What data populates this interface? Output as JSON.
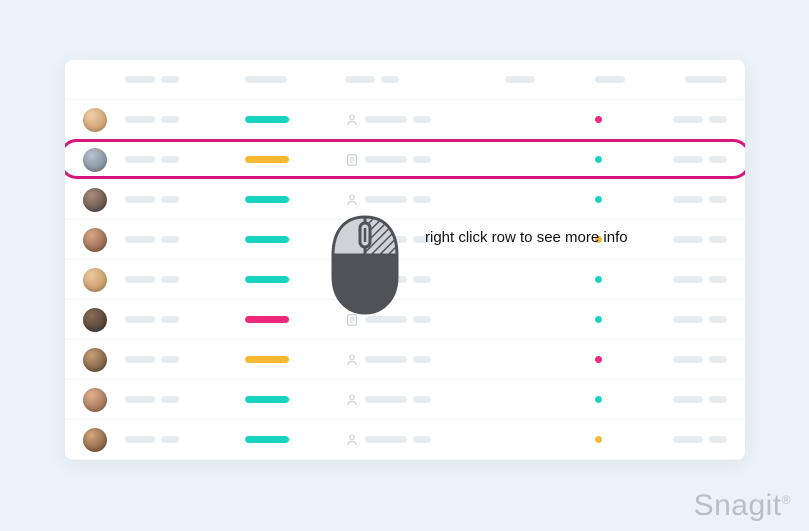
{
  "annotation": {
    "text": "right click row to see more info",
    "highlight_color": "#d6157d"
  },
  "watermark": {
    "brand": "Snagit",
    "mark": "®"
  },
  "colors": {
    "teal": "#17d3c0",
    "amber": "#f7b731",
    "pink": "#ef2879"
  },
  "highlighted_row_index": 1,
  "rows": [
    {
      "avatar": [
        "#c28a5a",
        "#f0cfa8"
      ],
      "status_color": "teal",
      "type_icon": "person",
      "dot_color": "pink"
    },
    {
      "avatar": [
        "#6b7c8a",
        "#b8c4cf"
      ],
      "status_color": "amber",
      "type_icon": "document",
      "dot_color": "teal"
    },
    {
      "avatar": [
        "#4a3c38",
        "#a98d7a"
      ],
      "status_color": "teal",
      "type_icon": "person",
      "dot_color": "teal"
    },
    {
      "avatar": [
        "#7a4d3a",
        "#d8a887"
      ],
      "status_color": "teal",
      "type_icon": "person",
      "dot_color": "amber"
    },
    {
      "avatar": [
        "#b88450",
        "#eccaa0"
      ],
      "status_color": "teal",
      "type_icon": "document",
      "dot_color": "teal"
    },
    {
      "avatar": [
        "#3a2e28",
        "#8a6e58"
      ],
      "status_color": "pink",
      "type_icon": "document",
      "dot_color": "teal"
    },
    {
      "avatar": [
        "#5a4230",
        "#c7a078"
      ],
      "status_color": "amber",
      "type_icon": "person",
      "dot_color": "pink"
    },
    {
      "avatar": [
        "#8a5a42",
        "#e0b090"
      ],
      "status_color": "teal",
      "type_icon": "person",
      "dot_color": "teal"
    },
    {
      "avatar": [
        "#6a4630",
        "#d2a878"
      ],
      "status_color": "teal",
      "type_icon": "person",
      "dot_color": "amber"
    }
  ]
}
